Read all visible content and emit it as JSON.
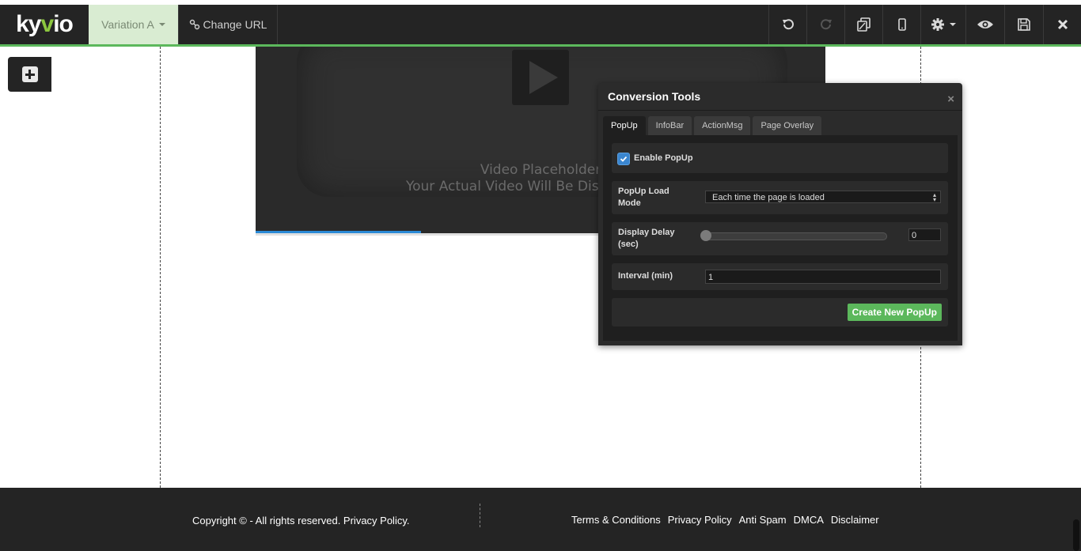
{
  "header": {
    "logo": "kyvio",
    "variation_label": "Variation A",
    "change_url_label": "Change URL",
    "tools": [
      "undo-icon",
      "redo-icon",
      "duplicate-icon",
      "mobile-icon",
      "gear-icon",
      "eye-icon",
      "save-icon",
      "close-icon"
    ]
  },
  "video": {
    "placeholder_line1": "Video Placeholder",
    "placeholder_line2": "Your Actual Video Will Be Dis",
    "progress": 0.29
  },
  "panel": {
    "title": "Conversion Tools",
    "close": "×",
    "tabs": [
      {
        "label": "PopUp",
        "active": true
      },
      {
        "label": "InfoBar",
        "active": false
      },
      {
        "label": "ActionMsg",
        "active": false
      },
      {
        "label": "Page Overlay",
        "active": false
      }
    ],
    "enable_label": "Enable PopUp",
    "enable_checked": true,
    "load_mode_label_1": "PopUp Load",
    "load_mode_label_2": "Mode",
    "load_mode_value": "Each time the page is loaded",
    "delay_label_1": "Display Delay",
    "delay_label_2": "(sec)",
    "delay_value": "0",
    "interval_label": "Interval (min)",
    "interval_value": "1",
    "create_label": "Create New PopUp"
  },
  "footer": {
    "copyright": "Copyright © - All rights reserved. Privacy Policy.",
    "links": [
      "Terms & Conditions",
      "Privacy Policy",
      "Anti Spam",
      "DMCA",
      "Disclaimer"
    ]
  },
  "colors": {
    "accent_green": "#5cb85c",
    "toolbar_bg": "#242424",
    "checkbox_blue": "#3a86d0",
    "video_progress": "#2b8ad6"
  }
}
